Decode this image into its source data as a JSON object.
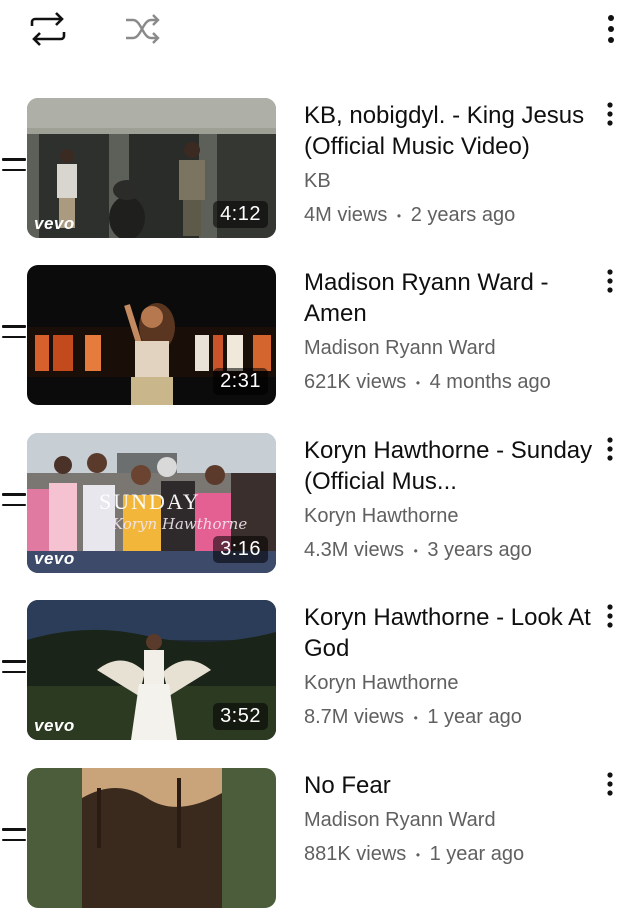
{
  "toolbar": {
    "repeat_icon": "repeat-icon",
    "shuffle_icon": "shuffle-icon",
    "more_icon": "more-vert-icon"
  },
  "playlist": [
    {
      "title": "KB, nobigdyl. - King Jesus (Official Music Video)",
      "channel": "KB",
      "views": "4M views",
      "age": "2 years ago",
      "duration": "4:12",
      "vevo": "vevo"
    },
    {
      "title": "Madison Ryann Ward - Amen",
      "channel": "Madison Ryann Ward",
      "views": "621K views",
      "age": "4 months ago",
      "duration": "2:31",
      "vevo": ""
    },
    {
      "title": "Koryn Hawthorne - Sunday (Official Mus...",
      "channel": "Koryn Hawthorne",
      "views": "4.3M views",
      "age": "3 years ago",
      "duration": "3:16",
      "vevo": "vevo",
      "thumb_text": "SUNDAY",
      "thumb_signature": "Koryn Hawthorne"
    },
    {
      "title": "Koryn Hawthorne - Look At God",
      "channel": "Koryn Hawthorne",
      "views": "8.7M views",
      "age": "1 year ago",
      "duration": "3:52",
      "vevo": "vevo"
    },
    {
      "title": "No Fear",
      "channel": "Madison Ryann Ward",
      "views": "881K views",
      "age": "1 year ago",
      "duration": "",
      "vevo": ""
    }
  ],
  "meta_separator": "•"
}
